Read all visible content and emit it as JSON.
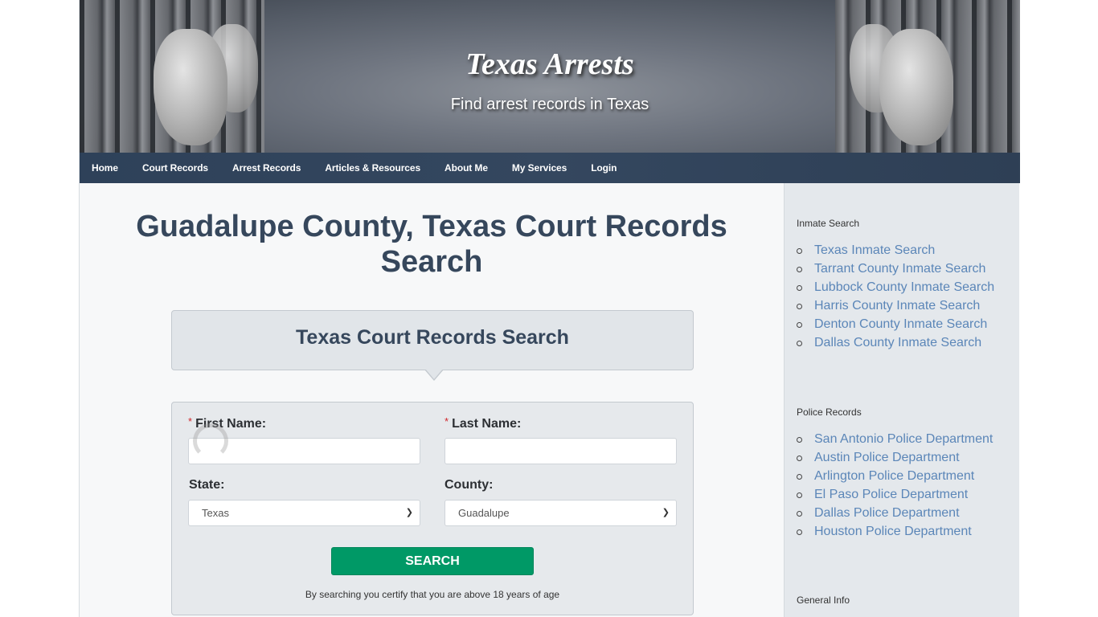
{
  "header": {
    "title": "Texas Arrests",
    "tagline": "Find arrest records in Texas"
  },
  "nav": {
    "items": [
      {
        "label": "Home"
      },
      {
        "label": "Court Records"
      },
      {
        "label": "Arrest Records"
      },
      {
        "label": "Articles & Resources"
      },
      {
        "label": "About Me"
      },
      {
        "label": "My Services"
      },
      {
        "label": "Login"
      }
    ]
  },
  "main": {
    "page_title": "Guadalupe County, Texas Court Records Search",
    "form_title": "Texas Court Records Search",
    "form": {
      "required_marker": "*",
      "first_name_label": "First Name:",
      "first_name_value": "",
      "last_name_label": "Last Name:",
      "last_name_value": "",
      "state_label": "State:",
      "state_value": "Texas",
      "county_label": "County:",
      "county_value": "Guadalupe",
      "search_button": "SEARCH",
      "disclaimer": "By searching you certify that you are above 18 years of age"
    }
  },
  "sidebar": {
    "sections": [
      {
        "heading": "Inmate Search",
        "links": [
          "Texas Inmate Search",
          "Tarrant County Inmate Search",
          "Lubbock County Inmate Search",
          "Harris County Inmate Search",
          "Denton County Inmate Search",
          "Dallas County Inmate Search"
        ]
      },
      {
        "heading": "Police Records",
        "links": [
          "San Antonio Police Department",
          "Austin Police Department",
          "Arlington Police Department",
          "El Paso Police Department",
          "Dallas Police Department",
          "Houston Police Department"
        ]
      },
      {
        "heading": "General Info",
        "links": []
      }
    ]
  },
  "colors": {
    "nav_bg": "#34475f",
    "title_text": "#36475c",
    "search_button": "#009966",
    "link": "#5b86b8",
    "required": "#d0262b"
  }
}
